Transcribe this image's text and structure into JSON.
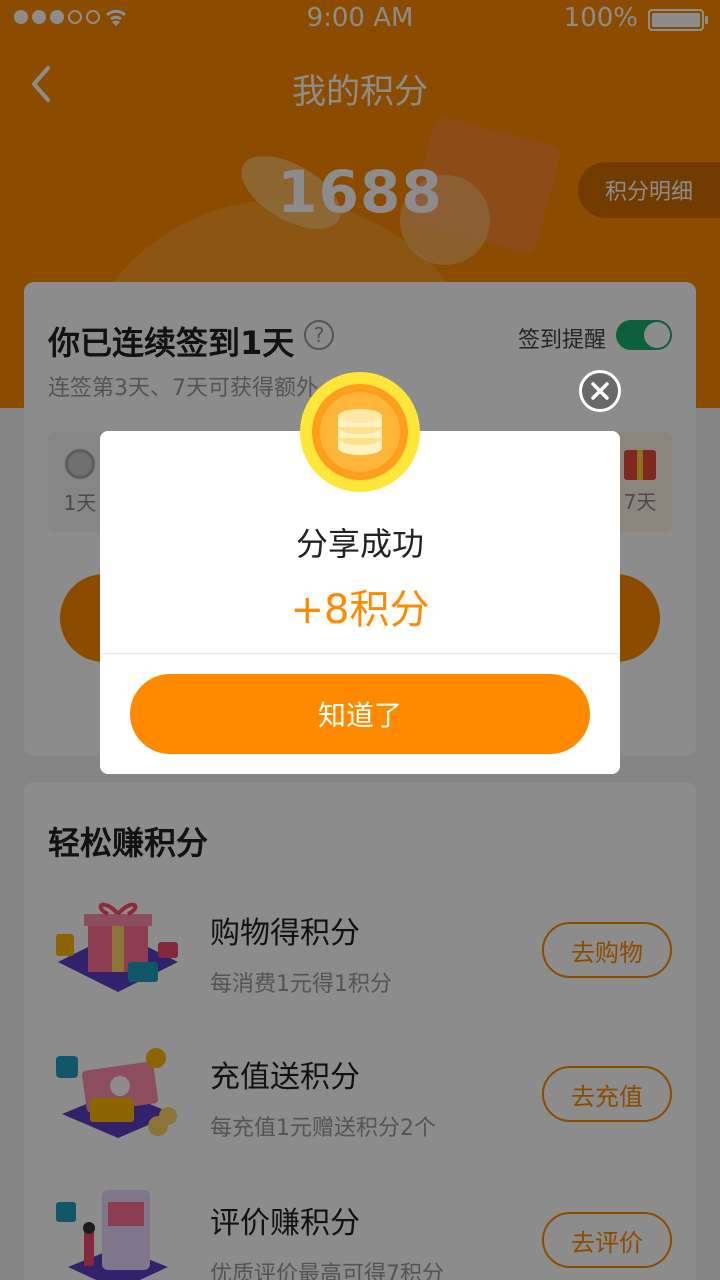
{
  "status_bar": {
    "time": "9:00 AM",
    "battery": "100%"
  },
  "nav": {
    "title": "我的积分"
  },
  "points": {
    "value": "1688",
    "detail_label": "积分明细"
  },
  "signin": {
    "title": "你已连续签到1天",
    "reminder_label": "签到提醒",
    "reminder_on": true,
    "subtitle": "连签第3天、7天可获得额外",
    "days": [
      {
        "label": "1天"
      },
      {
        "label": "7天"
      }
    ]
  },
  "earn": {
    "title": "轻松赚积分",
    "items": [
      {
        "name": "购物得积分",
        "desc": "每消费1元得1积分",
        "button": "去购物"
      },
      {
        "name": "充值送积分",
        "desc": "每充值1元赠送积分2个",
        "button": "去充值"
      },
      {
        "name": "评价赚积分",
        "desc": "优质评价最高可得7积分",
        "button": "去评价"
      }
    ]
  },
  "dialog": {
    "title": "分享成功",
    "points": "+8积分",
    "button": "知道了"
  },
  "colors": {
    "accent": "#ff8a00",
    "toggle": "#1aad6d"
  }
}
